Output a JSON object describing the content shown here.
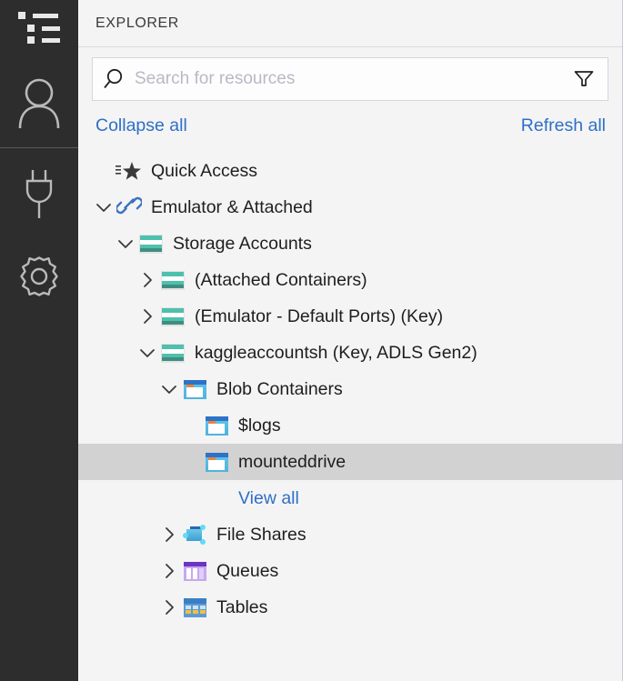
{
  "activity_bar": {
    "background": "#2d2d2d",
    "items": [
      {
        "name": "explorer-list-icon",
        "icon": "list-icon"
      },
      {
        "name": "account-icon",
        "icon": "person-icon"
      },
      {
        "name": "connect-icon",
        "icon": "plug-icon"
      },
      {
        "name": "settings-icon",
        "icon": "gear-icon"
      }
    ]
  },
  "explorer": {
    "title": "EXPLORER",
    "search": {
      "placeholder": "Search for resources",
      "value": "",
      "search_icon": "magnifier-icon",
      "filter_icon": "funnel-icon"
    },
    "actions": {
      "collapse_all": "Collapse all",
      "refresh_all": "Refresh all",
      "link_color": "#2f6fc5"
    },
    "tree": [
      {
        "label": "Quick Access",
        "icon": "quick-access-star-icon",
        "twisty": "none",
        "indent": 0,
        "selected": false
      },
      {
        "label": "Emulator & Attached",
        "icon": "link-chain-icon",
        "twisty": "expanded",
        "indent": 0,
        "selected": false
      },
      {
        "label": "Storage Accounts",
        "icon": "storage-account-icon",
        "twisty": "expanded",
        "indent": 1,
        "selected": false
      },
      {
        "label": "(Attached Containers)",
        "icon": "storage-account-icon",
        "twisty": "collapsed",
        "indent": 2,
        "selected": false
      },
      {
        "label": "(Emulator - Default Ports) (Key)",
        "icon": "storage-account-icon",
        "twisty": "collapsed",
        "indent": 2,
        "selected": false
      },
      {
        "label": "kaggleaccountsh (Key, ADLS Gen2)",
        "icon": "storage-account-icon",
        "twisty": "expanded",
        "indent": 2,
        "selected": false
      },
      {
        "label": "Blob Containers",
        "icon": "blob-container-icon",
        "twisty": "expanded",
        "indent": 3,
        "selected": false
      },
      {
        "label": "$logs",
        "icon": "blob-container-icon",
        "twisty": "none",
        "indent": 4,
        "selected": false
      },
      {
        "label": "mounteddrive",
        "icon": "blob-container-icon",
        "twisty": "none",
        "indent": 4,
        "selected": true
      },
      {
        "label": "View all",
        "icon": "none",
        "twisty": "none",
        "indent": 4,
        "selected": false,
        "is_link": true
      },
      {
        "label": "File Shares",
        "icon": "file-share-icon",
        "twisty": "collapsed",
        "indent": 3,
        "selected": false
      },
      {
        "label": "Queues",
        "icon": "queue-icon",
        "twisty": "collapsed",
        "indent": 3,
        "selected": false
      },
      {
        "label": "Tables",
        "icon": "table-icon",
        "twisty": "collapsed",
        "indent": 3,
        "selected": false
      }
    ],
    "selection_color": "#d2d2d2",
    "background": "#f4f4f5"
  }
}
